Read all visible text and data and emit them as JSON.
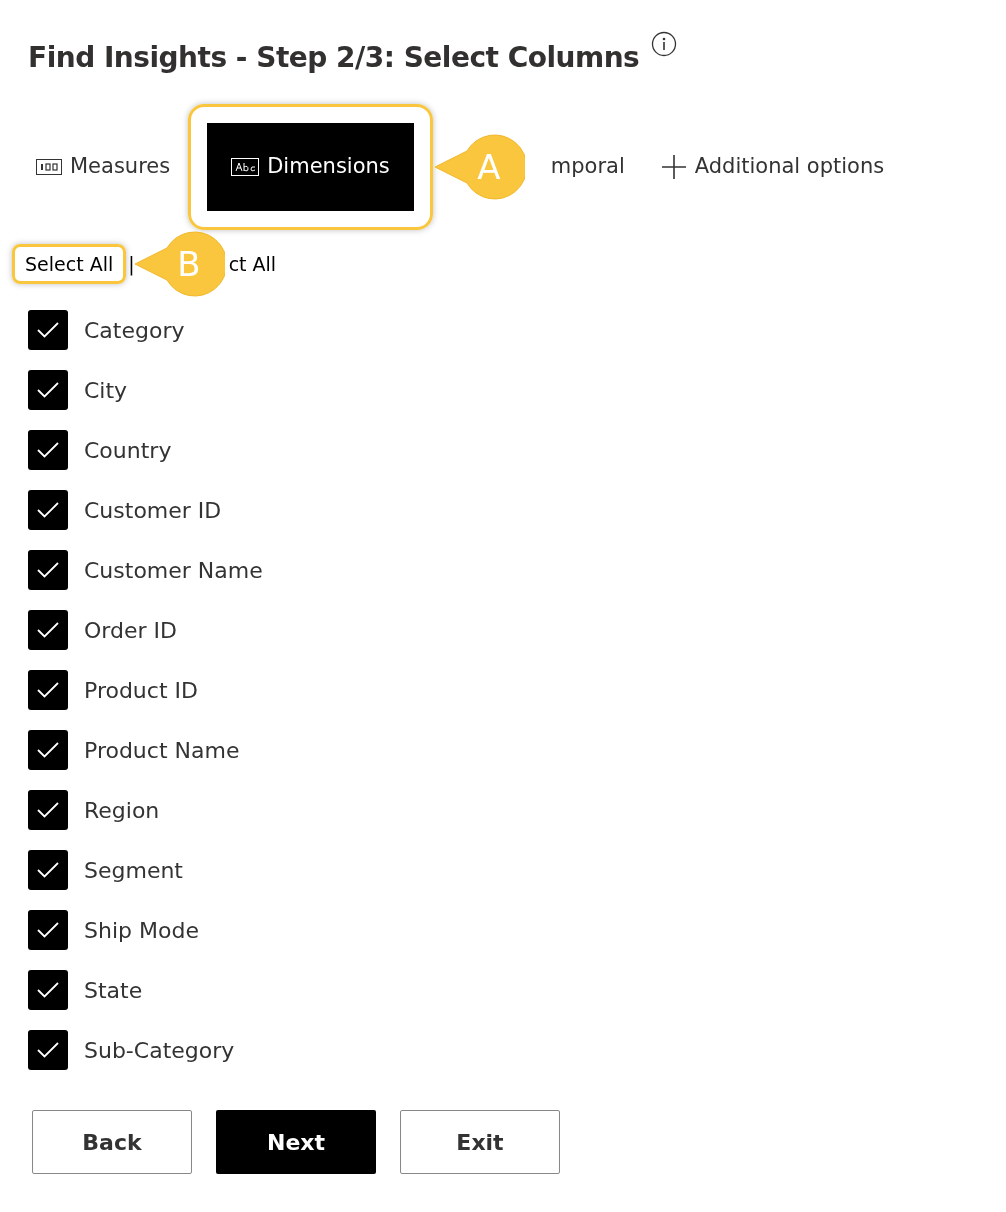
{
  "title": "Find Insights - Step 2/3: Select Columns",
  "tabs": [
    {
      "kind": "measures",
      "label": "Measures",
      "selected": false,
      "highlighted": false
    },
    {
      "kind": "dimensions",
      "label": "Dimensions",
      "selected": true,
      "highlighted": true
    },
    {
      "kind": "temporal",
      "label": "mporal",
      "selected": false,
      "highlighted": false
    },
    {
      "kind": "add",
      "label": "Additional options",
      "selected": false,
      "highlighted": false
    }
  ],
  "callouts": [
    {
      "label": "A"
    },
    {
      "label": "B"
    }
  ],
  "select_all": {
    "label": "Select All",
    "highlighted": true
  },
  "separator": "|",
  "deselect_all": {
    "label": "ct All"
  },
  "columns": [
    {
      "name": "Category",
      "checked": true
    },
    {
      "name": "City",
      "checked": true
    },
    {
      "name": "Country",
      "checked": true
    },
    {
      "name": "Customer ID",
      "checked": true
    },
    {
      "name": "Customer Name",
      "checked": true
    },
    {
      "name": "Order ID",
      "checked": true
    },
    {
      "name": "Product ID",
      "checked": true
    },
    {
      "name": "Product Name",
      "checked": true
    },
    {
      "name": "Region",
      "checked": true
    },
    {
      "name": "Segment",
      "checked": true
    },
    {
      "name": "Ship Mode",
      "checked": true
    },
    {
      "name": "State",
      "checked": true
    },
    {
      "name": "Sub-Category",
      "checked": true
    }
  ],
  "buttons": [
    {
      "label": "Back",
      "primary": false
    },
    {
      "label": "Next",
      "primary": true
    },
    {
      "label": "Exit",
      "primary": false
    }
  ]
}
